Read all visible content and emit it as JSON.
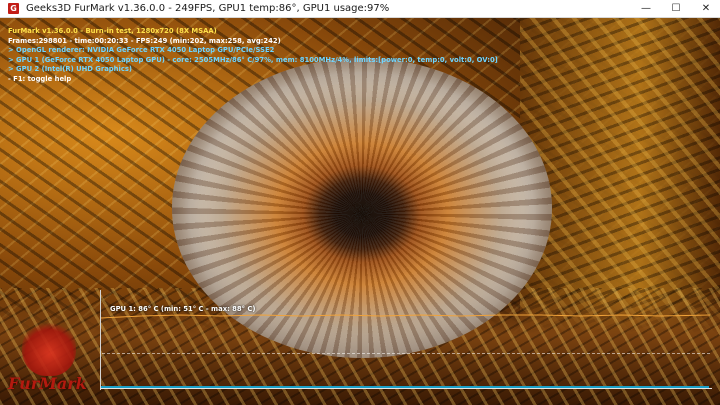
{
  "window": {
    "icon_letter": "G",
    "title": "Geeks3D FurMark v1.36.0.0 - 249FPS, GPU1 temp:86°, GPU1 usage:97%",
    "controls": {
      "minimize": "—",
      "maximize": "☐",
      "close": "✕"
    }
  },
  "hud": {
    "line1": "FurMark v1.36.0.0 - Burn-in test, 1280x720 (8X MSAA)",
    "line2": "Frames:298801 - time:00:20:33 - FPS:249 (min:202, max:258, avg:242)",
    "line3": "> OpenGL renderer: NVIDIA GeForce RTX 4050 Laptop GPU/PCIe/SSE2",
    "line4": "> GPU 1 (GeForce RTX 4050 Laptop GPU) - core: 2505MHz/86° C/97%, mem: 8100MHz/4%, limits:[power:0, temp:0, volt:0, OV:0]",
    "line5": "> GPU 2 (Intel(R) UHD Graphics)",
    "line6": "- F1: toggle help"
  },
  "graph": {
    "label": "GPU 1: 86° C (min: 51° C - max: 88° C)",
    "color": "#f0a23a"
  },
  "logo": {
    "text": "FurMark"
  },
  "colors": {
    "hud_title": "#ffe14a",
    "hud_info": "#6fd5ff",
    "brand_red": "#c21d17",
    "graph_axis_cyan": "#1aa0c8"
  }
}
